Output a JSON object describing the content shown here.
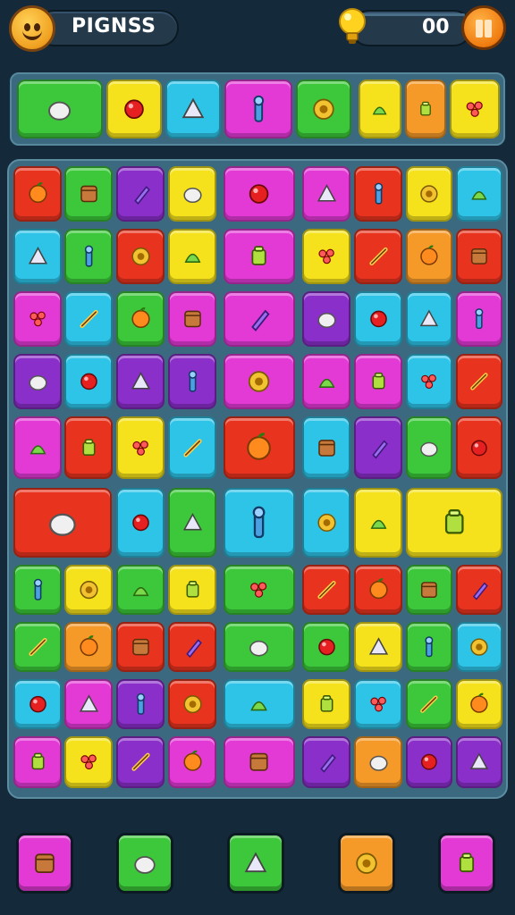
{
  "header": {
    "title": "PIGNSS",
    "score": "00"
  },
  "icons": {
    "player": "smiley-face-icon",
    "bonus": "lightbulb-icon",
    "pause": "pause-icon"
  },
  "palette": {
    "green": "#3cc83a",
    "yellow": "#f5e21c",
    "cyan": "#2ec4e8",
    "magenta": "#e33ad6",
    "purple": "#8a2fc9",
    "red": "#e8331e",
    "orange": "#f59a28",
    "darkbg": "#14293a",
    "panel": "#3b6a80"
  },
  "top_row": [
    {
      "color": "green",
      "icon": "mushroom-icon"
    },
    {
      "color": "yellow",
      "icon": "notepad-icon"
    },
    {
      "color": "cyan",
      "icon": "ring-icon"
    },
    {
      "color": "magenta",
      "icon": "pot-icon"
    },
    {
      "color": "green",
      "icon": "orange-icon"
    },
    {
      "color": "yellow",
      "icon": "pig-icon"
    },
    {
      "color": "orange",
      "icon": "wrench-icon"
    },
    {
      "color": "yellow",
      "icon": "cone-icon"
    }
  ],
  "board": [
    [
      "red",
      "green",
      "purple",
      "yellow",
      "magenta",
      "magenta",
      "red",
      "yellow",
      "cyan"
    ],
    [
      "cyan",
      "green",
      "red",
      "yellow",
      "magenta",
      "yellow",
      "red",
      "orange",
      "red"
    ],
    [
      "magenta",
      "cyan",
      "green",
      "magenta",
      "magenta",
      "purple",
      "cyan",
      "cyan",
      "magenta"
    ],
    [
      "purple",
      "cyan",
      "purple",
      "purple",
      "magenta",
      "magenta",
      "magenta",
      "cyan",
      "red"
    ],
    [
      "magenta",
      "red",
      "yellow",
      "cyan",
      "red",
      "cyan",
      "purple",
      "green",
      "red"
    ],
    [
      "red",
      "cyan",
      "green",
      "cyan",
      "cyan",
      "yellow",
      "yellow"
    ],
    [
      "green",
      "yellow",
      "green",
      "yellow",
      "green",
      "red",
      "red",
      "green",
      "red"
    ],
    [
      "green",
      "orange",
      "red",
      "red",
      "green",
      "green",
      "yellow",
      "green",
      "cyan"
    ],
    [
      "cyan",
      "magenta",
      "purple",
      "red",
      "cyan",
      "yellow",
      "cyan",
      "green",
      "yellow"
    ],
    [
      "magenta",
      "yellow",
      "purple",
      "magenta",
      "magenta",
      "purple",
      "orange",
      "purple",
      "purple"
    ]
  ],
  "bottom_buttons": [
    {
      "color": "magenta",
      "icon": "horn-icon"
    },
    {
      "color": "green",
      "icon": "tools-icon"
    },
    {
      "color": "green",
      "icon": "gear-icon"
    },
    {
      "color": "orange",
      "icon": "lollipop-icon"
    },
    {
      "color": "magenta",
      "icon": "cactus-icon"
    }
  ]
}
